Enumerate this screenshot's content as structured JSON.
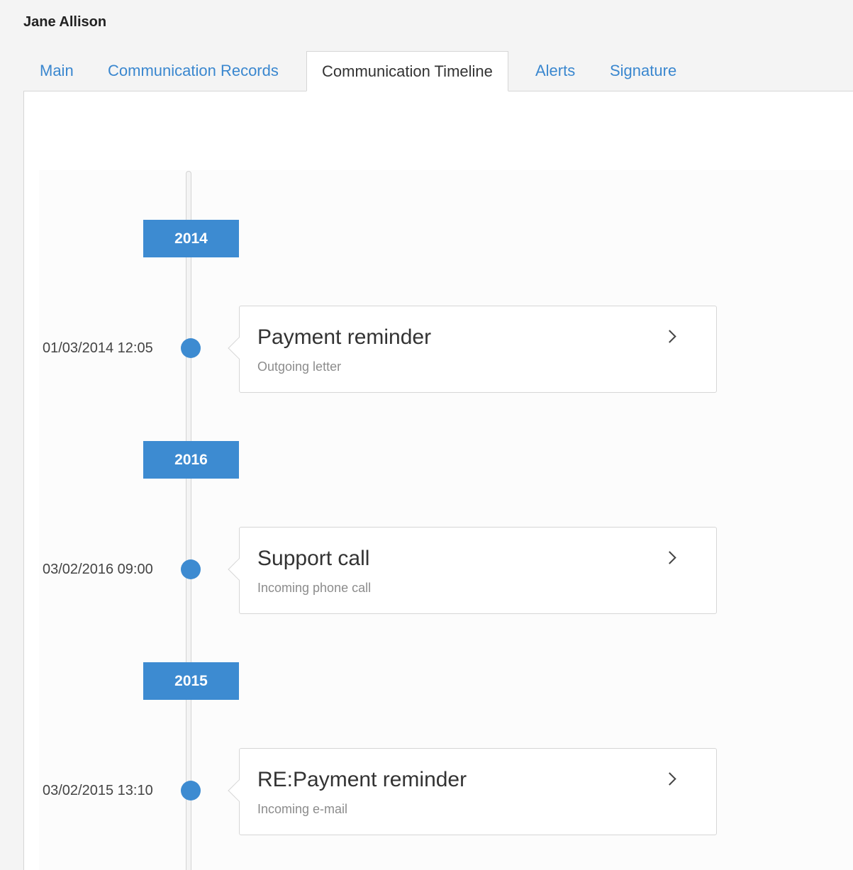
{
  "header": {
    "title": "Jane Allison"
  },
  "tabs": [
    {
      "label": "Main"
    },
    {
      "label": "Communication Records"
    },
    {
      "label": "Communication Timeline"
    },
    {
      "label": "Alerts"
    },
    {
      "label": "Signature"
    }
  ],
  "active_tab": "Communication Timeline",
  "colors": {
    "accent": "#3d8bd1",
    "link": "#3a87cf"
  },
  "timeline": {
    "years": [
      {
        "label": "2014"
      },
      {
        "label": "2016"
      },
      {
        "label": "2015"
      }
    ],
    "events": [
      {
        "datetime": "01/03/2014 12:05",
        "title": "Payment reminder",
        "type": "Outgoing letter",
        "icon": "chevron-right-icon"
      },
      {
        "datetime": "03/02/2016 09:00",
        "title": "Support call",
        "type": "Incoming phone call",
        "icon": "chevron-right-icon"
      },
      {
        "datetime": "03/02/2015 13:10",
        "title": "RE:Payment reminder",
        "type": "Incoming e-mail",
        "icon": "chevron-right-icon"
      }
    ]
  }
}
